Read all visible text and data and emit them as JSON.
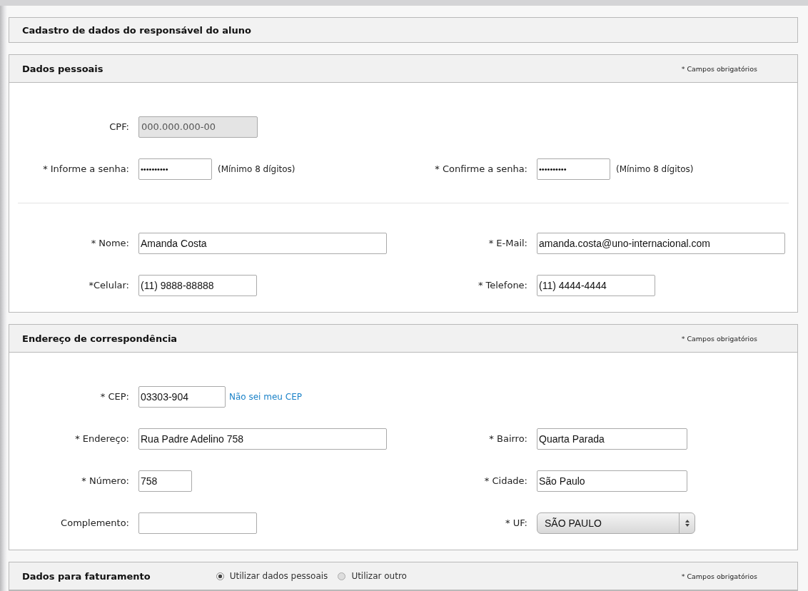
{
  "page_title": "Cadastro de dados do responsável do aluno",
  "sections": [
    {
      "title": "Dados pessoais",
      "required_note": "* Campos obrigatórios",
      "rows": [
        {
          "divider_before": false,
          "left": {
            "label": "CPF:",
            "value": "000.000.000-00",
            "kind": "disabled"
          }
        },
        {
          "divider_before": false,
          "left": {
            "label": "* Informe a senha:",
            "value": "••••••••••",
            "kind": "password",
            "hint": "(Mínimo 8 dígitos)"
          },
          "right": {
            "label": "* Confirme a senha:",
            "value": "••••••••••",
            "kind": "password",
            "hint": "(Mínimo 8 dígitos)"
          }
        },
        {
          "divider_before": true,
          "left": {
            "label": "* Nome:",
            "value": "Amanda Costa",
            "kind": "text"
          },
          "right": {
            "label": "* E-Mail:",
            "value": "amanda.costa@uno-internacional.com",
            "kind": "text"
          }
        },
        {
          "divider_before": false,
          "left": {
            "label": "*Celular:",
            "value": "(11) 9888-88888",
            "kind": "text"
          },
          "right": {
            "label": "* Telefone:",
            "value": "(11) 4444-4444",
            "kind": "text"
          }
        }
      ]
    },
    {
      "title": "Endereço de correspondência",
      "required_note": "* Campos obrigatórios",
      "rows": [
        {
          "divider_before": false,
          "left": {
            "label": "* CEP:",
            "value": "03303-904",
            "kind": "text",
            "link": "Não sei meu CEP"
          }
        },
        {
          "divider_before": false,
          "left": {
            "label": "* Endereço:",
            "value": "Rua Padre Adelino 758",
            "kind": "text"
          },
          "right": {
            "label": "* Bairro:",
            "value": "Quarta Parada",
            "kind": "text"
          }
        },
        {
          "divider_before": false,
          "left": {
            "label": "* Número:",
            "value": "758",
            "kind": "text"
          },
          "right": {
            "label": "* Cidade:",
            "value": "São Paulo",
            "kind": "text"
          }
        },
        {
          "divider_before": false,
          "left": {
            "label": "Complemento:",
            "kind": "text"
          },
          "right": {
            "label": "* UF:",
            "value": "SÃO PAULO",
            "kind": "select"
          }
        }
      ]
    },
    {
      "title": "Dados para faturamento",
      "required_note": "* Campos obrigatórios",
      "options": [
        {
          "label": "Utilizar dados pessoais",
          "selected": true
        },
        {
          "label": "Utilizar outro",
          "selected": false
        }
      ]
    }
  ]
}
